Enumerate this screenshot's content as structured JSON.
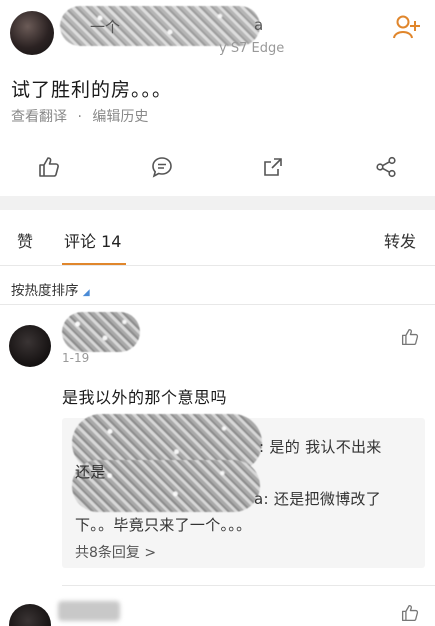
{
  "post": {
    "username_visible": "一个",
    "username_tail": "a",
    "device_tail": "y S7 Edge",
    "text": "试了胜利的房。。。",
    "link_translate": "查看翻译",
    "link_sep": "·",
    "link_history": "编辑历史"
  },
  "tabs": {
    "likes": "赞",
    "comments": "评论 14",
    "reposts": "转发"
  },
  "sort": {
    "label": "按热度排序",
    "indicator": "◢"
  },
  "comments": [
    {
      "date": "1-19",
      "text": "是我以外的那个意思吗",
      "replies": [
        {
          "tail": ": 是的 我认不出来",
          "tail2": "还是"
        },
        {
          "tail": "a: 还是把微博改了",
          "line2": "下。。毕竟只来了一个。。。"
        }
      ],
      "more": "共8条回复 >"
    }
  ],
  "colors": {
    "accent": "#e0862c",
    "sort_indicator": "#4a8bd6"
  }
}
